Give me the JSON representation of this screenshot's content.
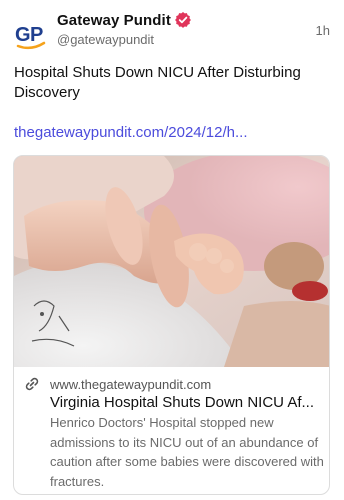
{
  "author": {
    "name": "Gateway Pundit",
    "handle": "@gatewaypundit",
    "avatar_text": "GP",
    "verified_icon": "verified-badge-icon",
    "verified_color": "#e0345a"
  },
  "post": {
    "time": "1h",
    "text": "Hospital Shuts Down NICU After Disturbing Discovery",
    "link": "thegatewaypundit.com/2024/12/h..."
  },
  "card": {
    "domain": "www.thegatewaypundit.com",
    "title": "Virginia Hospital Shuts Down NICU Af...",
    "description": "Henrico Doctors' Hospital stopped new admissions to its NICU out of an abundance of caution after some babies were discovered with fractures.",
    "link_icon": "link-icon",
    "image_icon": "photo-baby-hand"
  },
  "colors": {
    "link": "#4c4cdc",
    "muted": "#6b6b6b",
    "avatar_blue": "#1f3f8f",
    "avatar_orange": "#f5a21b"
  }
}
